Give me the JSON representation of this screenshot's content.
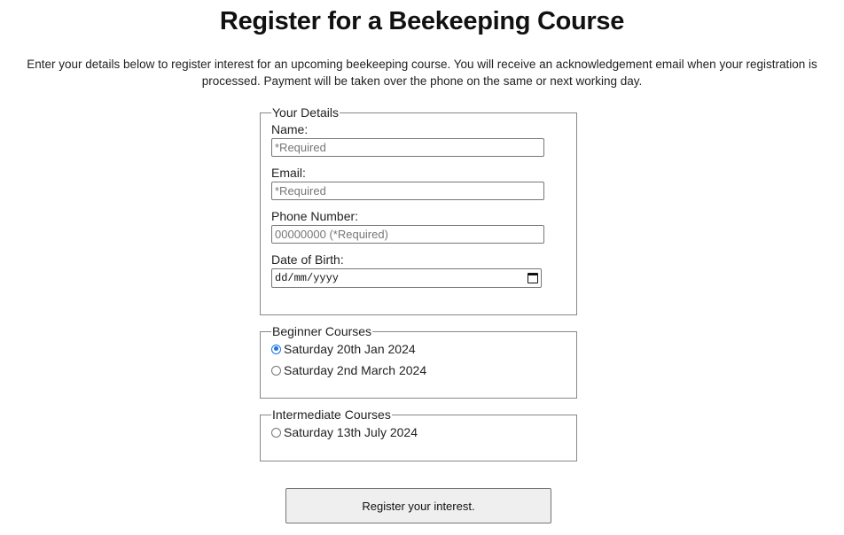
{
  "page": {
    "title": "Register for a Beekeeping Course",
    "intro": "Enter your details below to register interest for an upcoming beekeeping course. You will receive an acknowledgement email when your registration is processed. Payment will be taken over the phone on the same or next working day."
  },
  "details": {
    "legend": "Your Details",
    "name_label": "Name:",
    "name_placeholder": "*Required",
    "email_label": "Email:",
    "email_placeholder": "*Required",
    "phone_label": "Phone Number:",
    "phone_placeholder": "00000000 (*Required)",
    "dob_label": "Date of Birth:",
    "dob_placeholder": "dd/mm/yyyy"
  },
  "beginner": {
    "legend": "Beginner Courses",
    "options": [
      {
        "label": "Saturday 20th Jan 2024",
        "checked": true
      },
      {
        "label": "Saturday 2nd March 2024",
        "checked": false
      }
    ]
  },
  "intermediate": {
    "legend": "Intermediate Courses",
    "options": [
      {
        "label": "Saturday 13th July 2024",
        "checked": false
      }
    ]
  },
  "submit_label": "Register your interest.",
  "colors": {
    "radio_accent": "#1a73e8",
    "button_bg": "#efefef"
  },
  "icons": {
    "date_picker": "calendar-icon"
  }
}
